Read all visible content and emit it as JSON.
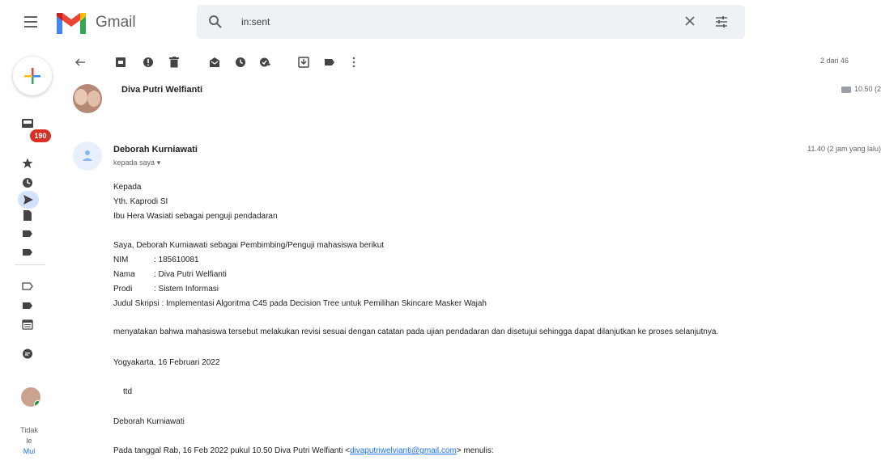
{
  "app": {
    "name": "Gmail"
  },
  "search": {
    "value": "in:sent"
  },
  "rail": {
    "badge_count": "190",
    "status_lines": [
      "Tidak",
      "le",
      "Mul"
    ]
  },
  "toolbar": {
    "pager": "2 dari 46"
  },
  "message1": {
    "sender": "Diva Putri Welfianti",
    "time": "10.50 (2"
  },
  "message2": {
    "sender": "Deborah Kurniawati",
    "recipient": "kepada saya",
    "time": "11.40 (2 jam yang lalu)",
    "greeting": "Kepada",
    "to_line1": "Yth. Kaprodi SI",
    "to_line2": "Ibu Hera Wasiati sebagai penguji pendadaran",
    "intro": "Saya, Deborah Kurniawati sebagai Pembimbing/Penguji mahasiswa berikut",
    "fields": [
      {
        "label": "NIM",
        "value": ": 185610081"
      },
      {
        "label": "Nama",
        "value": ": Diva Putri Welfianti"
      },
      {
        "label": "Prodi",
        "value": ": Sistem Informasi"
      }
    ],
    "thesis": "Judul Skripsi : Implementasi Algoritma C45 pada Decision Tree untuk Pemilihan Skincare Masker Wajah",
    "statement": "menyatakan bahwa mahasiswa tersebut melakukan revisi sesuai dengan catatan pada ujian pendadaran dan disetujui sehingga dapat dilanjutkan ke proses selanjutnya.",
    "place_date": "Yogyakarta, 16 Februari 2022",
    "ttd": "ttd",
    "signature": "Deborah Kurniawati",
    "quote_prefix": "Pada tanggal Rab, 16 Feb 2022 pukul 10.50 Diva Putri Welfianti <",
    "quote_email": "divaputriwelvianti@gmail.com",
    "quote_suffix": "> menulis:"
  }
}
